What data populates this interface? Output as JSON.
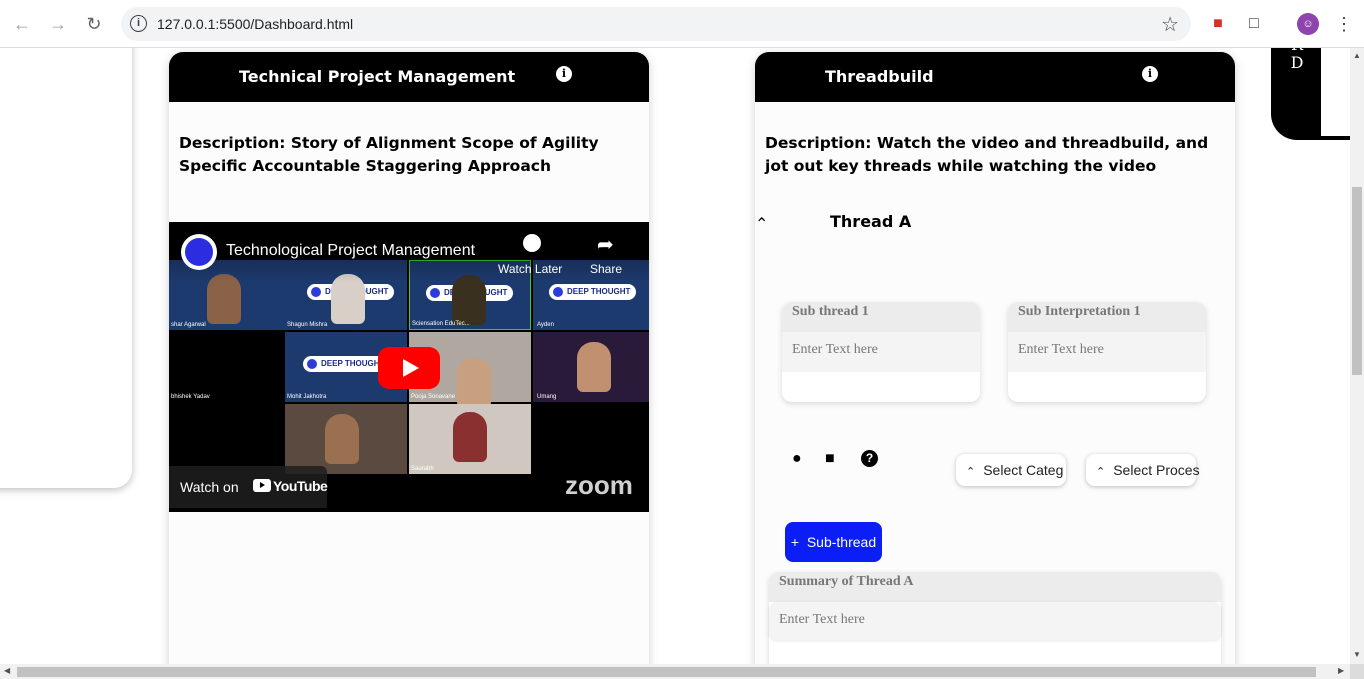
{
  "browser": {
    "url": "127.0.0.1:5500/Dashboard.html"
  },
  "cards": [
    {
      "title": "Technical Project Management",
      "description_label": "Description:",
      "description_text": " Story of Alignment Scope of Agility Specific Accountable Staggering Approach",
      "video": {
        "title": "Technological Project Management",
        "watch_later": "Watch Later",
        "share": "Share",
        "watch_on": "Watch on",
        "platform": "YouTube",
        "overlay_brand": "zoom",
        "badge_text": "DEEP THOUGHT",
        "participants": [
          "shar Agarwal",
          "Shagun Mishra",
          "Sciensation EduTec...",
          "Ayden",
          "bhishek Yadav",
          "Mohit Jakhotra",
          "Pooja Sonavane",
          "Umang",
          "Saurabh"
        ]
      }
    },
    {
      "title": "Threadbuild",
      "description_label": "Description:",
      "description_text": " Watch the video and threadbuild, and jot out key threads while watching the video",
      "thread": {
        "name": "Thread A",
        "sub_thread_label": "Sub thread 1",
        "sub_thread_placeholder": "Enter Text here",
        "sub_interp_label": "Sub Interpretation 1",
        "sub_interp_placeholder": "Enter Text here",
        "select_category": "Select Categ",
        "select_process": "Select Proces",
        "add_subthread": "Sub-thread",
        "summary_label": "Summary of Thread A",
        "summary_placeholder": "Enter Text here"
      }
    }
  ],
  "right_tab_text": "R\nD",
  "colors": {
    "accent": "#0a1ef5",
    "header": "#000000",
    "play": "#ff0000"
  }
}
